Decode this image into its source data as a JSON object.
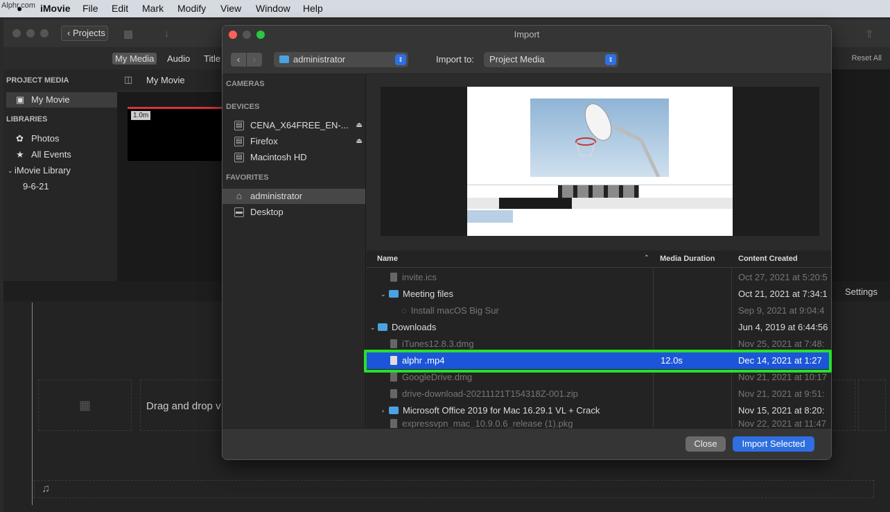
{
  "menubar": {
    "watermark": "Alphr.com",
    "app": "iMovie",
    "items": [
      "File",
      "Edit",
      "Mark",
      "Modify",
      "View",
      "Window",
      "Help"
    ]
  },
  "imovie": {
    "projects_label": "Projects",
    "tabs": [
      "My Media",
      "Audio",
      "Title"
    ],
    "reset_all": "Reset All",
    "project_media_head": "PROJECT MEDIA",
    "project_item": "My Movie",
    "libraries_head": "LIBRARIES",
    "library_items": [
      "Photos",
      "All Events",
      "iMovie Library",
      "9-6-21"
    ],
    "browser_title": "My Movie",
    "clip_duration": "1.0m",
    "settings": "Settings",
    "timeline_hint": "Drag and drop v"
  },
  "dialog": {
    "title": "Import",
    "location": "administrator",
    "import_to_label": "Import to:",
    "import_to_value": "Project Media",
    "sidebar": {
      "cameras_head": "CAMERAS",
      "devices_head": "DEVICES",
      "devices": [
        "CENA_X64FREE_EN-...",
        "Firefox",
        "Macintosh HD"
      ],
      "favorites_head": "FAVORITES",
      "favorites": [
        "administrator",
        "Desktop"
      ]
    },
    "columns": [
      "Name",
      "Media Duration",
      "Content Created"
    ],
    "rows": [
      {
        "name": "invite.ics",
        "duration": "",
        "created": "Oct 27, 2021 at 5:20:5"
      },
      {
        "name": "Meeting files",
        "duration": "",
        "created": "Oct 21, 2021 at 7:34:1"
      },
      {
        "name": "Install macOS Big Sur",
        "duration": "",
        "created": "Sep 9, 2021 at 9:04:4"
      },
      {
        "name": "Downloads",
        "duration": "",
        "created": "Jun 4, 2019 at 6:44:56"
      },
      {
        "name": "iTunes12.8.3.dmg",
        "duration": "",
        "created": "Nov 25, 2021 at 7:48:"
      },
      {
        "name": "alphr .mp4",
        "duration": "12.0s",
        "created": "Dec 14, 2021 at 1:27"
      },
      {
        "name": "GoogleDrive.dmg",
        "duration": "",
        "created": "Nov 21, 2021 at 10:17"
      },
      {
        "name": "drive-download-20211121T154318Z-001.zip",
        "duration": "",
        "created": "Nov 21, 2021 at 9:51:"
      },
      {
        "name": "Microsoft Office 2019 for Mac 16.29.1 VL + Crack",
        "duration": "",
        "created": "Nov 15, 2021 at 8:20:"
      },
      {
        "name": "expressvpn_mac_10.9.0.6_release (1).pkg",
        "duration": "",
        "created": "Nov 22, 2021 at 11:47"
      }
    ],
    "close_label": "Close",
    "import_label": "Import Selected",
    "highlight_color": "#28e028",
    "selection_color": "#1c55d8"
  }
}
